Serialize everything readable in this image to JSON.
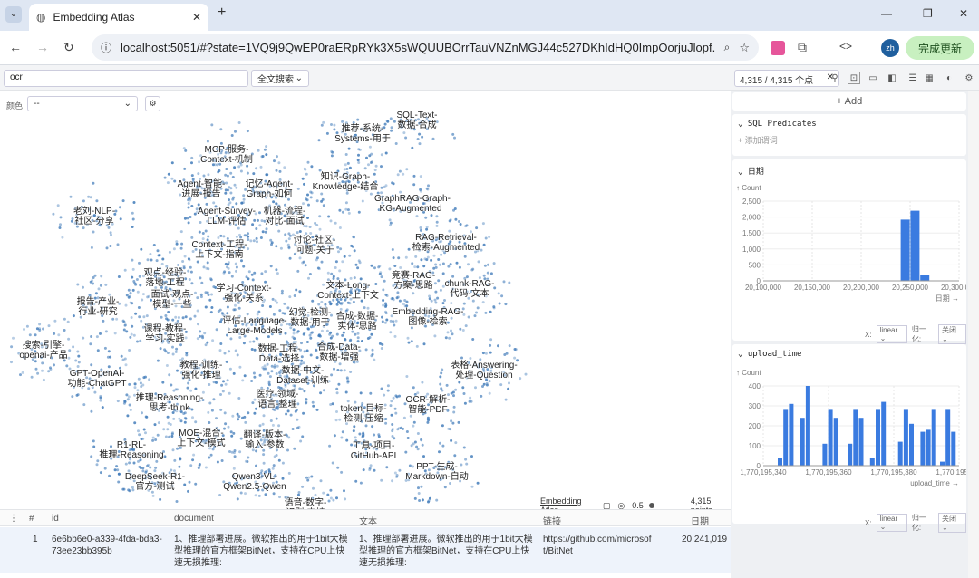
{
  "browser": {
    "tab_title": "Embedding Atlas",
    "url": "localhost:5051/#?state=1VQ9j9QwEP0raERpRYk3X5sWQUUBOrrTauVNZnMGJ44c527DKhIdHQ0ImpOorjuJlopf...",
    "profile": "zh",
    "update_label": "完成更新"
  },
  "toolbar": {
    "search_value": "ocr",
    "search_mode": "全文搜索",
    "count": "4,315 / 4,315 个点"
  },
  "plot": {
    "color_label": "颜色",
    "color_value": "--",
    "footer_title": "Embedding Atlas",
    "point_size": "0.5",
    "points": "4,315 points"
  },
  "labels": [
    {
      "t": "SQL-Text-\n数据-合成",
      "x": 460,
      "y": 32
    },
    {
      "t": "推荐-系统-\nSystems-用于",
      "x": 400,
      "y": 47
    },
    {
      "t": "MCP-服务-\nContext-机制",
      "x": 250,
      "y": 70
    },
    {
      "t": "Agent-智能-\n进展-报告",
      "x": 222,
      "y": 108
    },
    {
      "t": "记忆-Agent-\nGraph-如何",
      "x": 297,
      "y": 108
    },
    {
      "t": "知识-Graph-\nKnowledge-结合",
      "x": 381,
      "y": 100
    },
    {
      "t": "GraphRAG-Graph-\nKG-Augmented",
      "x": 453,
      "y": 124
    },
    {
      "t": "老刘-NLP-\n社区-分享",
      "x": 104,
      "y": 138
    },
    {
      "t": "Agent-Survey-\nLLM-评估",
      "x": 250,
      "y": 138
    },
    {
      "t": "机器-流程-\n对比-面试",
      "x": 314,
      "y": 138
    },
    {
      "t": "讨论-社区-\n问题-关于",
      "x": 347,
      "y": 170
    },
    {
      "t": "RAG-Retrieval-\n检索-Augmented",
      "x": 492,
      "y": 167
    },
    {
      "t": "Context-工程-\n上下文-指南",
      "x": 242,
      "y": 175
    },
    {
      "t": "观点-经验-\n落地-工程",
      "x": 182,
      "y": 206
    },
    {
      "t": "竞赛-RAG-\n方案-思路",
      "x": 456,
      "y": 209
    },
    {
      "t": "chunk-RAG-\n代码-文本",
      "x": 518,
      "y": 218
    },
    {
      "t": "学习-Context-\n强化-关系",
      "x": 269,
      "y": 223
    },
    {
      "t": "文本-Long-\nContext-上下文",
      "x": 384,
      "y": 220
    },
    {
      "t": "报告-产业-\n行业-研究",
      "x": 108,
      "y": 238
    },
    {
      "t": "面试-观点-\n模型-一些",
      "x": 190,
      "y": 230
    },
    {
      "t": "幻觉-检测-\n数据-用于",
      "x": 342,
      "y": 250
    },
    {
      "t": "合成-数据-\n实体-思路",
      "x": 394,
      "y": 254
    },
    {
      "t": "Embedding-RAG-\n图像-检索",
      "x": 472,
      "y": 249
    },
    {
      "t": "评估-Language-\nLarge-Models",
      "x": 281,
      "y": 259
    },
    {
      "t": "课程-教程-\n学习-实践",
      "x": 182,
      "y": 268
    },
    {
      "t": "搜索-引擎-\nopenai-产品",
      "x": 48,
      "y": 286
    },
    {
      "t": "数据-工程-\nData-选择",
      "x": 308,
      "y": 290
    },
    {
      "t": "合成-Data-\n数据-增强",
      "x": 374,
      "y": 288
    },
    {
      "t": "教程-训练-\n强化-推理",
      "x": 222,
      "y": 308
    },
    {
      "t": "表格-Answering-\n处理-Question",
      "x": 534,
      "y": 308
    },
    {
      "t": "GPT-OpenAI-\n功能-ChatGPT",
      "x": 107,
      "y": 317
    },
    {
      "t": "数据-中文-\nDataset-训练",
      "x": 334,
      "y": 314
    },
    {
      "t": "推理-Reasoning-\n思考-think",
      "x": 187,
      "y": 344
    },
    {
      "t": "医疗-领域-\n语言-整理",
      "x": 306,
      "y": 340
    },
    {
      "t": "OCR-解析-\n智能-PDF",
      "x": 472,
      "y": 346
    },
    {
      "t": "token-目标-\n检测-压缩",
      "x": 401,
      "y": 356
    },
    {
      "t": "MOE-混合-\n上下文-模式",
      "x": 222,
      "y": 383
    },
    {
      "t": "翻译-版本-\n输入-参数",
      "x": 292,
      "y": 385
    },
    {
      "t": "R1-RL-\n推理-Reasoning",
      "x": 145,
      "y": 396
    },
    {
      "t": "工具-项目-\nGitHub-API",
      "x": 412,
      "y": 397
    },
    {
      "t": "DeepSeek-R1-\n官方-测试",
      "x": 171,
      "y": 431
    },
    {
      "t": "PPT-生成-\nMarkdown-自动",
      "x": 482,
      "y": 420
    },
    {
      "t": "Qwen3-VL-\nQwen2.5-Qwen",
      "x": 281,
      "y": 431
    },
    {
      "t": "语音-数字-\n识别-支持",
      "x": 337,
      "y": 460
    }
  ],
  "sidebar": {
    "add_label": "+ Add",
    "sql_title": "SQL Predicates",
    "sql_add": "+ 添加谓词",
    "date_title": "日期",
    "upload_title": "upload_time",
    "count_label": "↑ Count",
    "scale_label": "X:",
    "scale_value": "linear",
    "norm_label": "归一化:",
    "norm_value": "关闭"
  },
  "chart_data": [
    {
      "type": "bar",
      "title": "日期",
      "ylabel": "↑ Count",
      "xlabel": "日期 →",
      "ylim": [
        0,
        2500
      ],
      "yticks": [
        "0",
        "500",
        "1,000",
        "1,500",
        "2,000",
        "2,500"
      ],
      "xticks": [
        "20,100,000",
        "20,150,000",
        "20,200,000",
        "20,250,000",
        "20,300,000"
      ],
      "xlim": [
        20100000,
        20300000
      ],
      "bins": [
        {
          "x": 20150000,
          "v": 10
        },
        {
          "x": 20245000,
          "v": 1920
        },
        {
          "x": 20255000,
          "v": 2200
        },
        {
          "x": 20265000,
          "v": 180
        }
      ]
    },
    {
      "type": "bar",
      "title": "upload_time",
      "ylabel": "↑ Count",
      "xlabel": "upload_time →",
      "ylim": [
        0,
        400
      ],
      "yticks": [
        "0",
        "100",
        "200",
        "300",
        "400"
      ],
      "xticks": [
        "1,770,195,340",
        "1,770,195,360",
        "1,770,195,380",
        "1,770,195,400"
      ],
      "xlim": [
        1770195335,
        1770195405
      ],
      "bins": [
        {
          "x": 1770195341,
          "v": 40
        },
        {
          "x": 1770195343,
          "v": 280
        },
        {
          "x": 1770195345,
          "v": 310
        },
        {
          "x": 1770195349,
          "v": 240
        },
        {
          "x": 1770195351,
          "v": 400
        },
        {
          "x": 1770195357,
          "v": 110
        },
        {
          "x": 1770195359,
          "v": 280
        },
        {
          "x": 1770195361,
          "v": 240
        },
        {
          "x": 1770195366,
          "v": 110
        },
        {
          "x": 1770195368,
          "v": 280
        },
        {
          "x": 1770195370,
          "v": 240
        },
        {
          "x": 1770195374,
          "v": 40
        },
        {
          "x": 1770195376,
          "v": 280
        },
        {
          "x": 1770195378,
          "v": 320
        },
        {
          "x": 1770195384,
          "v": 120
        },
        {
          "x": 1770195386,
          "v": 280
        },
        {
          "x": 1770195388,
          "v": 210
        },
        {
          "x": 1770195392,
          "v": 170
        },
        {
          "x": 1770195394,
          "v": 180
        },
        {
          "x": 1770195396,
          "v": 280
        },
        {
          "x": 1770195399,
          "v": 20
        },
        {
          "x": 1770195401,
          "v": 280
        },
        {
          "x": 1770195403,
          "v": 170
        }
      ]
    }
  ],
  "table": {
    "headers": [
      "#",
      "id",
      "document",
      "文本",
      "链接",
      "日期"
    ],
    "row": {
      "n": "1",
      "id": "6e6bb6e0-a339-4fda-bda3-73ee23bb395b",
      "document": "1、推理部署进展。微软推出的用于1bit大模型推理的官方框架BitNet，支持在CPU上快速无损推理:",
      "text": "1、推理部署进展。微软推出的用于1bit大模型推理的官方框架BitNet，支持在CPU上快速无损推理:",
      "link": "https://github.com/microsoft/BitNet",
      "date": "20,241,019"
    }
  }
}
